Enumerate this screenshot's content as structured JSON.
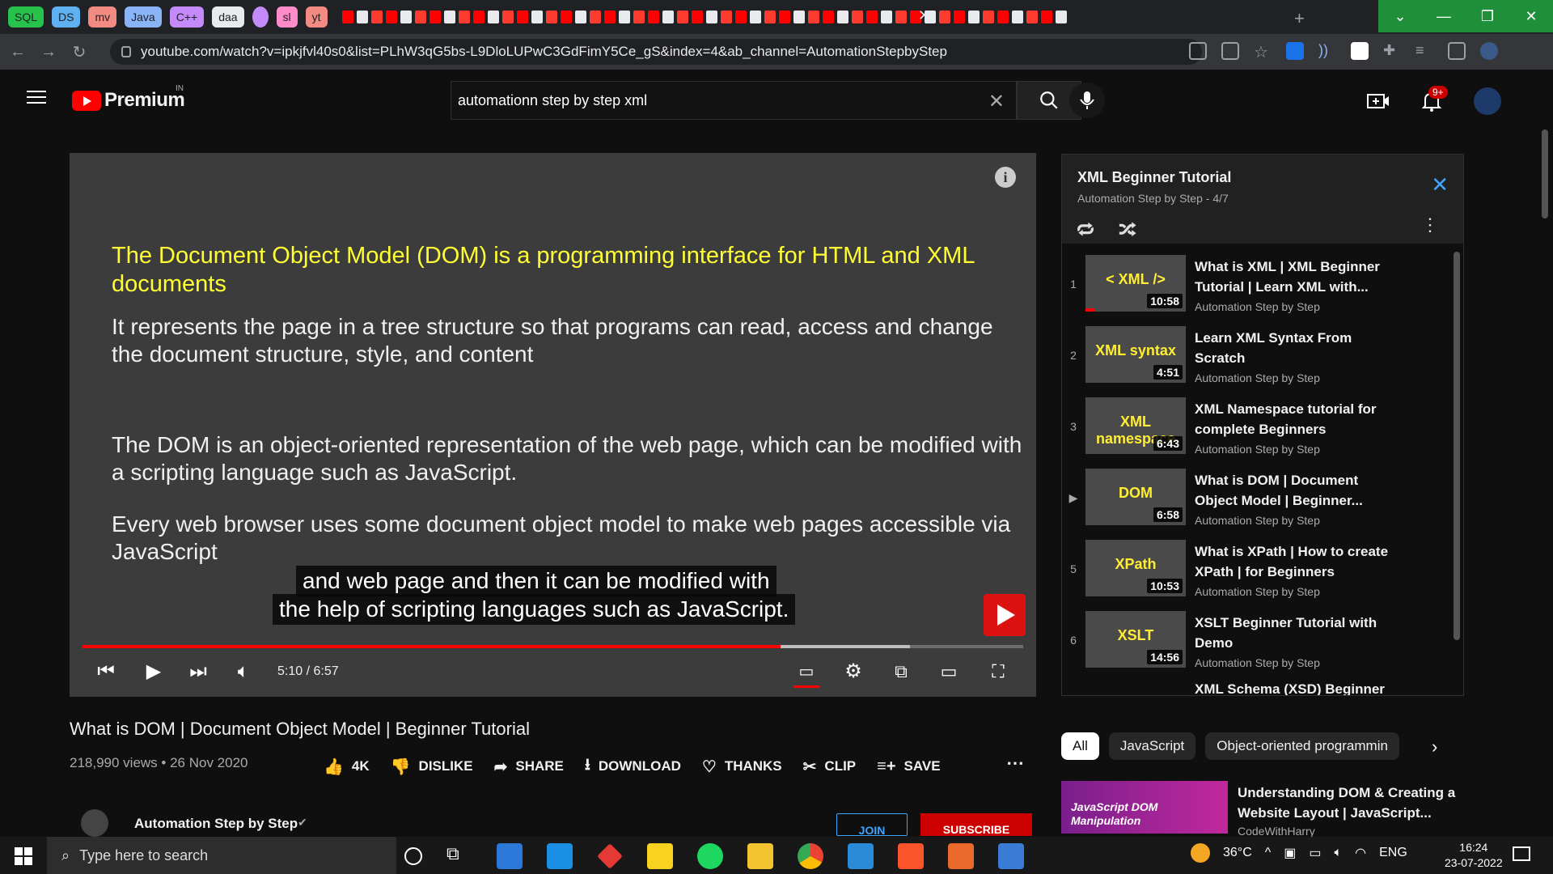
{
  "browser": {
    "pinned_tabs": [
      {
        "label": "SQL",
        "color": "#27c24c"
      },
      {
        "label": "DS",
        "color": "#5fb0f0"
      },
      {
        "label": "mv",
        "color": "#f28b82"
      },
      {
        "label": "Java",
        "color": "#8ab4f8"
      },
      {
        "label": "C++",
        "color": "#c58af9"
      },
      {
        "label": "daa",
        "color": "#e8eaed"
      },
      {
        "label": "",
        "color": "#c58af9"
      },
      {
        "label": "sl",
        "color": "#ff8bcb"
      },
      {
        "label": "yt",
        "color": "#f28b82"
      }
    ],
    "url": "youtube.com/watch?v=ipkjfvl40s0&list=PLhW3qG5bs-L9DloLUPwC3GdFimY5Ce_gS&index=4&ab_channel=AutomationStepbyStep"
  },
  "youtube": {
    "logo_text": "Premium",
    "region": "IN",
    "search_query": "automationn step by step xml",
    "notification_count": "9+"
  },
  "player": {
    "slide_title": "The Document Object Model (DOM) is a programming interface for HTML and XML documents",
    "slide_paragraphs": [
      "It represents the page in a tree structure so that programs can read, access and change the document structure, style, and content",
      "The DOM is an object-oriented representation of the web page, which can be modified with a scripting language such as JavaScript.",
      "Every web browser uses some document object model to make web pages accessible via JavaScript"
    ],
    "captions": [
      "and web page and then it can be modified with",
      "the help of scripting languages such as JavaScript."
    ],
    "time": "5:10 / 6:57",
    "progress_fraction": 0.742,
    "buffer_fraction": 0.88
  },
  "video": {
    "title": "What is DOM | Document Object Model | Beginner Tutorial",
    "views_date": "218,990 views • 26 Nov 2020",
    "actions": [
      {
        "icon": "thumbs-up-icon",
        "glyph": "👍",
        "label": "4K"
      },
      {
        "icon": "thumbs-down-icon",
        "glyph": "👎",
        "label": "DISLIKE"
      },
      {
        "icon": "share-icon",
        "glyph": "➦",
        "label": "SHARE"
      },
      {
        "icon": "download-icon",
        "glyph": "⭳",
        "label": "DOWNLOAD"
      },
      {
        "icon": "thanks-icon",
        "glyph": "♡",
        "label": "THANKS"
      },
      {
        "icon": "clip-icon",
        "glyph": "✂",
        "label": "CLIP"
      },
      {
        "icon": "save-icon",
        "glyph": "≡+",
        "label": "SAVE"
      }
    ],
    "more_label": "⋯",
    "channel_name": "Automation Step by Step",
    "join_label": "JOIN",
    "subscribe_label": "SUBSCRIBE"
  },
  "playlist": {
    "title": "XML Beginner Tutorial",
    "subtitle": "Automation Step by Step - 4/7",
    "items": [
      {
        "index": "1",
        "thumb": "< XML />",
        "duration": "10:58",
        "title": "What is XML | XML Beginner Tutorial | Learn XML with...",
        "channel": "Automation Step by Step",
        "watched": 0.1
      },
      {
        "index": "2",
        "thumb": "XML syntax",
        "duration": "4:51",
        "title": "Learn XML Syntax From Scratch",
        "channel": "Automation Step by Step",
        "watched": 0
      },
      {
        "index": "3",
        "thumb": "XML namespace",
        "duration": "6:43",
        "title": "XML Namespace tutorial for complete Beginners",
        "channel": "Automation Step by Step",
        "watched": 0
      },
      {
        "index": "▶",
        "thumb": "DOM",
        "duration": "6:58",
        "title": "What is DOM | Document Object Model | Beginner...",
        "channel": "Automation Step by Step",
        "watched": 0
      },
      {
        "index": "5",
        "thumb": "XPath",
        "duration": "10:53",
        "title": "What is XPath | How to create XPath | for Beginners",
        "channel": "Automation Step by Step",
        "watched": 0
      },
      {
        "index": "6",
        "thumb": "XSLT",
        "duration": "14:56",
        "title": "XSLT Beginner Tutorial with Demo",
        "channel": "Automation Step by Step",
        "watched": 0
      },
      {
        "index": "",
        "thumb": "",
        "duration": "",
        "title": "XML Schema (XSD) Beginner",
        "channel": "",
        "watched": 0
      }
    ]
  },
  "chips": [
    "All",
    "JavaScript",
    "Object-oriented programmin"
  ],
  "recommendation": {
    "thumb_label": "JavaScript DOM Manipulation",
    "title": "Understanding DOM & Creating a Website Layout | JavaScript...",
    "channel": "CodeWithHarry"
  },
  "taskbar": {
    "search_placeholder": "Type here to search",
    "weather": "36°C",
    "language": "ENG",
    "time": "16:24",
    "date": "23-07-2022"
  }
}
